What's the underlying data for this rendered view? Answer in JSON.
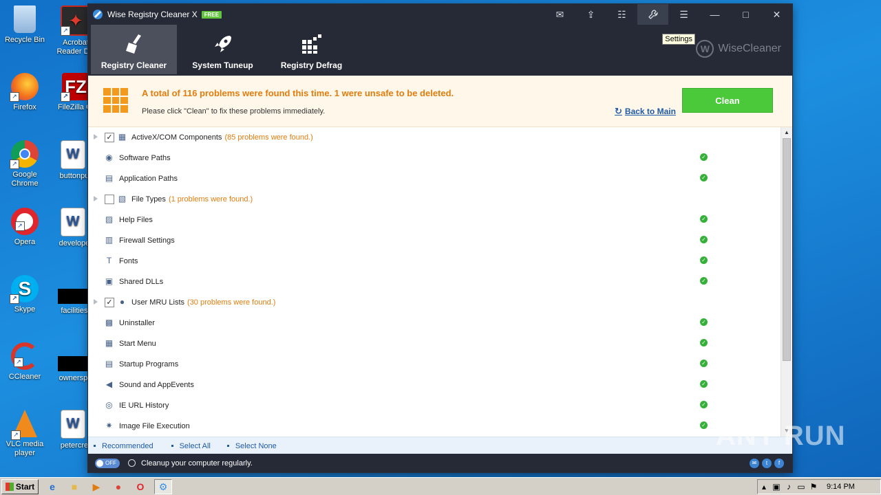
{
  "desktop": {
    "icons": [
      {
        "label": "Recycle Bin",
        "icon": "recycle-bin-icon"
      },
      {
        "label": "Acrobat Reader DC",
        "icon": "acrobat-icon"
      },
      {
        "label": "Firefox",
        "icon": "firefox-icon"
      },
      {
        "label": "FileZilla Client",
        "icon": "filezilla-icon"
      },
      {
        "label": "Google Chrome",
        "icon": "chrome-icon"
      },
      {
        "label": "buttonpub",
        "icon": "word-doc-icon"
      },
      {
        "label": "Opera",
        "icon": "opera-icon"
      },
      {
        "label": "developed",
        "icon": "word-doc-icon"
      },
      {
        "label": "Skype",
        "icon": "skype-icon"
      },
      {
        "label": "facilitieso",
        "icon": "black-file-icon"
      },
      {
        "label": "CCleaner",
        "icon": "ccleaner-icon"
      },
      {
        "label": "ownerspm",
        "icon": "black-file-icon"
      },
      {
        "label": "VLC media player",
        "icon": "vlc-icon"
      },
      {
        "label": "petercrea",
        "icon": "word-doc-icon"
      }
    ]
  },
  "window": {
    "title": "Wise Registry Cleaner X",
    "badge": "FREE",
    "tooltip": "Settings",
    "brand": "WiseCleaner",
    "brand_letter": "W"
  },
  "nav": {
    "tabs": [
      {
        "label": "Registry Cleaner",
        "active": true
      },
      {
        "label": "System Tuneup",
        "active": false
      },
      {
        "label": "Registry Defrag",
        "active": false
      }
    ]
  },
  "banner": {
    "headline": "A total of 116 problems were found this time. 1 were unsafe to be deleted.",
    "sub": "Please click \"Clean\" to fix these problems immediately.",
    "back_label": "Back to Main",
    "clean_label": "Clean"
  },
  "list": [
    {
      "name": "ActiveX/COM Components",
      "count": "(85 problems were found.)",
      "group": true,
      "checked": true,
      "ok": false
    },
    {
      "name": "Software Paths",
      "count": "",
      "group": false,
      "checked": false,
      "ok": true
    },
    {
      "name": "Application Paths",
      "count": "",
      "group": false,
      "checked": false,
      "ok": true
    },
    {
      "name": "File Types",
      "count": "(1 problems were found.)",
      "group": true,
      "checked": false,
      "ok": false
    },
    {
      "name": "Help Files",
      "count": "",
      "group": false,
      "checked": false,
      "ok": true
    },
    {
      "name": "Firewall Settings",
      "count": "",
      "group": false,
      "checked": false,
      "ok": true
    },
    {
      "name": "Fonts",
      "count": "",
      "group": false,
      "checked": false,
      "ok": true
    },
    {
      "name": "Shared DLLs",
      "count": "",
      "group": false,
      "checked": false,
      "ok": true
    },
    {
      "name": "User MRU Lists",
      "count": "(30 problems were found.)",
      "group": true,
      "checked": true,
      "ok": false
    },
    {
      "name": "Uninstaller",
      "count": "",
      "group": false,
      "checked": false,
      "ok": true
    },
    {
      "name": "Start Menu",
      "count": "",
      "group": false,
      "checked": false,
      "ok": true
    },
    {
      "name": "Startup Programs",
      "count": "",
      "group": false,
      "checked": false,
      "ok": true
    },
    {
      "name": "Sound and AppEvents",
      "count": "",
      "group": false,
      "checked": false,
      "ok": true
    },
    {
      "name": "IE URL History",
      "count": "",
      "group": false,
      "checked": false,
      "ok": true
    },
    {
      "name": "Image File Execution",
      "count": "",
      "group": false,
      "checked": false,
      "ok": true
    }
  ],
  "footer": {
    "recommended": "Recommended",
    "select_all": "Select All",
    "select_none": "Select None"
  },
  "status": {
    "toggle_state": "OFF",
    "text": "Cleanup your computer regularly."
  },
  "taskbar": {
    "start_label": "Start",
    "time": "9:14 PM"
  },
  "watermark": "ANY RUN",
  "colors": {
    "accent_orange": "#e07d0e",
    "clean_green": "#4cc93a",
    "dark_header": "#252a36",
    "link_blue": "#1e5aa6",
    "ok_green": "#35b13a"
  }
}
